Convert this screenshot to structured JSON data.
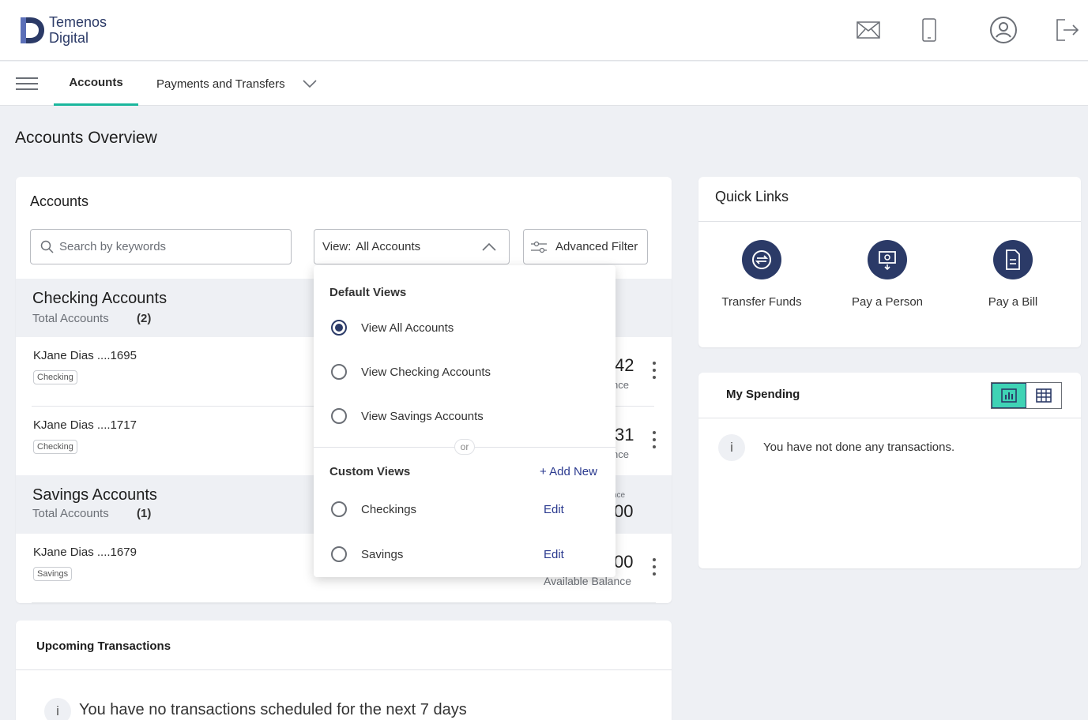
{
  "brand": {
    "line1": "Temenos",
    "line2": "Digital"
  },
  "header_icons": [
    "mail-icon",
    "mobile-icon",
    "profile-icon",
    "logout-icon"
  ],
  "nav": {
    "tabs": [
      {
        "label": "Accounts"
      },
      {
        "label": "Payments and Transfers"
      }
    ]
  },
  "page": {
    "title": "Accounts Overview"
  },
  "accounts_card": {
    "title": "Accounts",
    "search_placeholder": "Search by keywords",
    "view_label": "View:",
    "view_value": "All Accounts",
    "advanced_filter": "Advanced Filter",
    "groups": [
      {
        "name": "Checking Accounts",
        "sub": "Total Accounts",
        "count": "(2)",
        "accounts": [
          {
            "name": "KJane Dias ....1695",
            "tag": "Checking",
            "balance_fragment": "42",
            "label_fragment": "nce"
          },
          {
            "name": "KJane Dias ....1717",
            "tag": "Checking",
            "balance_fragment": "31",
            "label_fragment": "nce"
          }
        ]
      },
      {
        "name": "Savings Accounts",
        "sub": "Total Accounts",
        "count": "(1)",
        "balance_fragment": "00",
        "label_fragment": "nce",
        "accounts": [
          {
            "name": "KJane Dias ....1679",
            "tag": "Savings",
            "balance_fragment": "00",
            "label_fragment": "Available Balance"
          }
        ]
      }
    ]
  },
  "view_dropdown": {
    "default_title": "Default Views",
    "default_options": [
      {
        "label": "View All Accounts",
        "selected": true
      },
      {
        "label": "View Checking Accounts",
        "selected": false
      },
      {
        "label": "View Savings Accounts",
        "selected": false
      }
    ],
    "or_label": "or",
    "custom_title": "Custom Views",
    "add_new": "+ Add New",
    "custom_options": [
      {
        "label": "Checkings",
        "edit": "Edit"
      },
      {
        "label": "Savings",
        "edit": "Edit"
      }
    ]
  },
  "quick_links": {
    "title": "Quick Links",
    "items": [
      {
        "label": "Transfer Funds",
        "icon": "transfer-icon"
      },
      {
        "label": "Pay a Person",
        "icon": "pay-person-icon"
      },
      {
        "label": "Pay a Bill",
        "icon": "bill-icon"
      }
    ]
  },
  "my_spending": {
    "title": "My Spending",
    "message": "You have not done any transactions.",
    "info_glyph": "i"
  },
  "upcoming": {
    "title": "Upcoming Transactions",
    "message": "You have no transactions scheduled for the next 7 days",
    "info_glyph": "i"
  },
  "colors": {
    "brand": "#2b3a67",
    "accent": "#1bb79d",
    "background": "#eef0f4"
  }
}
